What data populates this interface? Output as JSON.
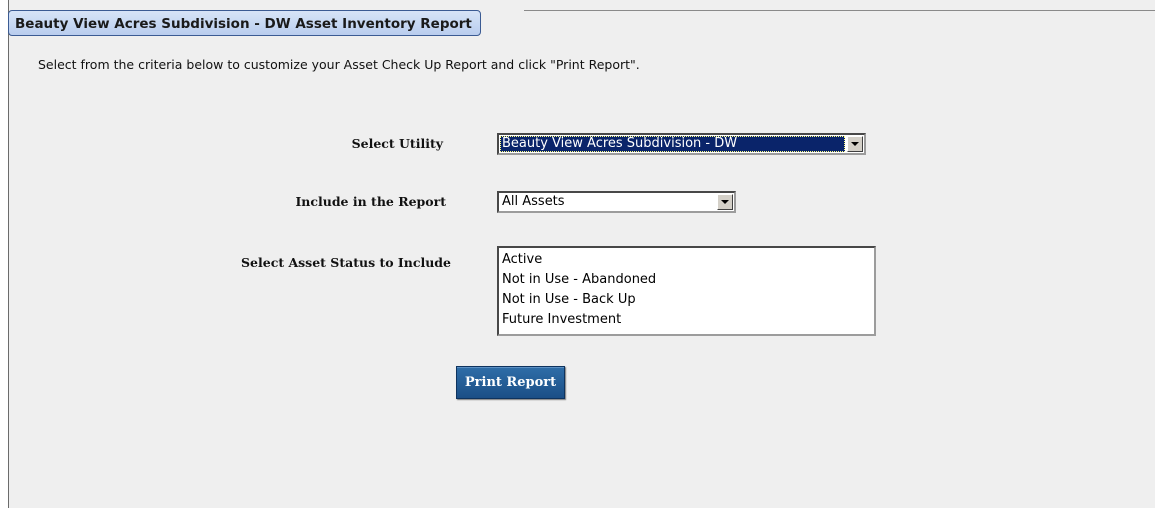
{
  "header": {
    "title": "Beauty View Acres Subdivision - DW Asset Inventory Report"
  },
  "instructions": "Select from the criteria below to customize your Asset Check Up Report and click \"Print Report\".",
  "form": {
    "utility": {
      "label": "Select Utility",
      "value": "Beauty View Acres Subdivision - DW"
    },
    "include": {
      "label": "Include in the Report",
      "value": "All Assets"
    },
    "status": {
      "label": "Select Asset Status to Include",
      "options": [
        "Active",
        "Not in Use - Abandoned",
        "Not in Use - Back Up",
        "Future Investment"
      ]
    }
  },
  "actions": {
    "print_label": "Print Report"
  },
  "colors": {
    "button_bg": "#1b4f86",
    "selected_bg": "#0a246a",
    "tab_bg": "#c8d9f2",
    "panel_bg": "#efefef"
  },
  "icons": {
    "dropdown": "chevron-down-icon"
  }
}
